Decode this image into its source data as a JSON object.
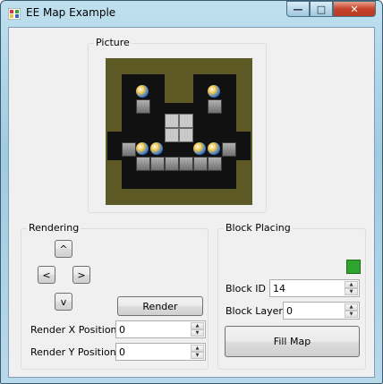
{
  "window": {
    "title": "EE Map Example"
  },
  "picture": {
    "label": "Picture"
  },
  "rendering": {
    "label": "Rendering",
    "up": "^",
    "left": "<",
    "right": ">",
    "down": "v",
    "render_button": "Render",
    "x_label": "Render X Position",
    "x_value": "0",
    "y_label": "Render Y Position",
    "y_value": "0"
  },
  "block_placing": {
    "label": "Block Placing",
    "id_label": "Block ID",
    "id_value": "14",
    "layer_label": "Block Layer",
    "layer_value": "0",
    "fill_button": "Fill Map",
    "indicator_color": "#2ea52e"
  },
  "colors": {
    "map_border": "#5d5a25",
    "map_bg": "#111111"
  }
}
